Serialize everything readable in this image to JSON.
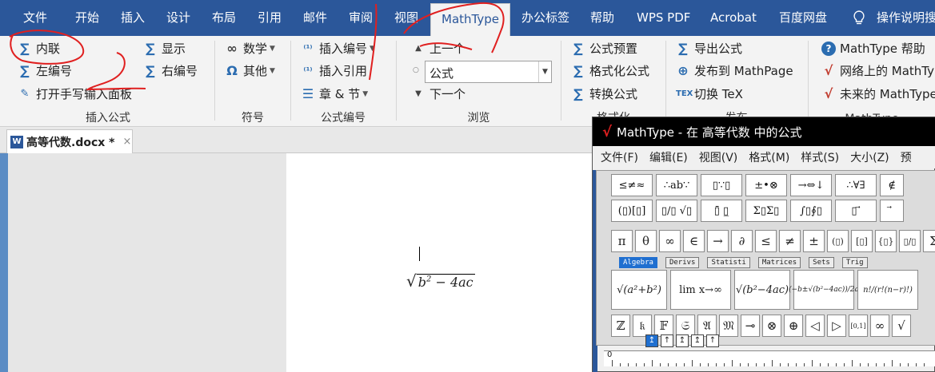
{
  "menubar": {
    "tabs": [
      {
        "label": "文件"
      },
      {
        "label": "开始"
      },
      {
        "label": "插入"
      },
      {
        "label": "设计"
      },
      {
        "label": "布局"
      },
      {
        "label": "引用"
      },
      {
        "label": "邮件"
      },
      {
        "label": "审阅"
      },
      {
        "label": "视图"
      },
      {
        "label": "MathType"
      },
      {
        "label": "办公标签"
      },
      {
        "label": "帮助"
      },
      {
        "label": "WPS PDF"
      },
      {
        "label": "Acrobat"
      },
      {
        "label": "百度网盘"
      },
      {
        "label": "操作说明搜"
      }
    ],
    "active_tab": "MathType"
  },
  "ribbon": {
    "insert_formula": {
      "label": "插入公式",
      "inline": "内联",
      "left_number": "左编号",
      "display": "显示",
      "right_number": "右编号",
      "handwriting": "打开手写输入面板"
    },
    "symbols": {
      "label": "符号",
      "math": "数学",
      "other": "其他"
    },
    "formula_number": {
      "label": "公式编号",
      "insert_number": "插入编号",
      "insert_ref": "插入引用",
      "chapter_section": "章 & 节"
    },
    "browse": {
      "label": "浏览",
      "prev": "上一个",
      "next": "下一个",
      "combo_value": "公式"
    },
    "format": {
      "label": "格式化",
      "preset": "公式预置",
      "format_formula": "格式化公式",
      "convert": "转换公式"
    },
    "publish": {
      "label": "发布",
      "export": "导出公式",
      "publish_mathpage": "发布到 MathPage",
      "toggle_tex": "切换 TeX"
    },
    "mathtype_help": {
      "label": "MathType",
      "help": "MathType 帮助",
      "online": "网络上的 MathTy",
      "future": "未来的 MathType"
    }
  },
  "document": {
    "tab_title": "高等代数.docx *",
    "close_glyph": "×",
    "formula_text": "b",
    "formula_exp": "2",
    "formula_rest": " − 4ac",
    "radical": "√"
  },
  "mathtype_window": {
    "title": "MathType - 在 高等代数 中的公式",
    "menu": [
      "文件(F)",
      "编辑(E)",
      "视图(V)",
      "格式(M)",
      "样式(S)",
      "大小(Z)",
      "预"
    ],
    "palette_row1": [
      "≤≠≈",
      "∴ab∵",
      "▯∵▯",
      "±•⊗",
      "→⇔↓",
      "∴∀∃",
      "∉"
    ],
    "palette_row2": [
      "(▯)[▯]",
      "▯/▯ √▯",
      "▯̄ ▯̲",
      "Σ▯Σ▯",
      "∫▯∮▯",
      "▯ ⃗",
      "⃗"
    ],
    "symbol_row": [
      "π",
      "θ",
      "∞",
      "∈",
      "→",
      "∂",
      "≤",
      "≠",
      "±",
      "(▯)",
      "[▯]",
      "{▯}",
      "▯/▯",
      "Σ"
    ],
    "palette_tabs": [
      "Algebra",
      "Derivs",
      "Statisti",
      "Matrices",
      "Sets",
      "Trig"
    ],
    "template_row": [
      "√(a²+b²)",
      "lim x→∞",
      "√(b²−4ac)",
      "(−b±√(b²−4ac))/2a",
      "n!/(r!(n−r)!)"
    ],
    "small_row": [
      "ℤ",
      "𝔨",
      "𝔽",
      "𝔖",
      "𝔄",
      "𝔐",
      "⊸",
      "⊗",
      "⊕",
      "◁",
      "▷",
      "[0,1]",
      "∞",
      "√"
    ],
    "size_buttons": [
      "↥",
      "↑",
      "↥",
      "↥",
      "↑"
    ],
    "ruler_zero": "0"
  },
  "colors": {
    "accent": "#2b579a",
    "annotation": "#e02020",
    "highlight": "#1f6fd0"
  }
}
